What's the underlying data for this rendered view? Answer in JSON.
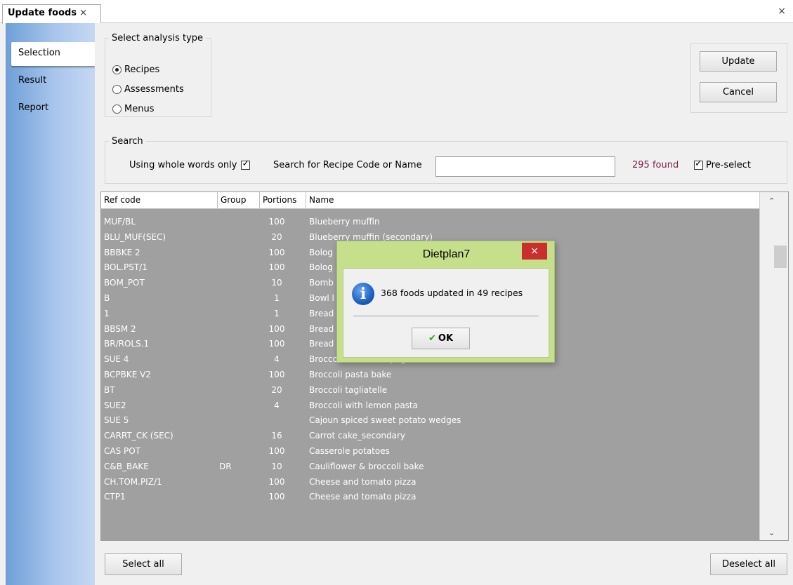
{
  "tab": {
    "title": "Update foods",
    "close": "×"
  },
  "window_close": "×",
  "sidebar": {
    "items": [
      {
        "label": "Selection"
      },
      {
        "label": "Result"
      },
      {
        "label": "Report"
      }
    ]
  },
  "analysis": {
    "legend": "Select analysis type",
    "options": [
      {
        "label": "Recipes",
        "checked": true
      },
      {
        "label": "Assessments",
        "checked": false
      },
      {
        "label": "Menus",
        "checked": false
      }
    ]
  },
  "actions": {
    "update_label": "Update",
    "cancel_label": "Cancel"
  },
  "search": {
    "legend": "Search",
    "whole_words_label": "Using whole words only",
    "whole_words_checked": true,
    "search_label": "Search for Recipe Code or Name",
    "search_value": "",
    "found_text": "295 found",
    "preselect_label": "Pre-select",
    "preselect_checked": true
  },
  "grid": {
    "headers": {
      "ref": "Ref code",
      "group": "Group",
      "portions": "Portions",
      "name": "Name"
    },
    "rows": [
      {
        "ref": "MUF/BL",
        "group": "",
        "portions": "100",
        "name": "Blueberry muffin"
      },
      {
        "ref": "BLU_MUF(SEC)",
        "group": "",
        "portions": "20",
        "name": "Blueberry muffin (secondary)"
      },
      {
        "ref": "BBBKE 2",
        "group": "",
        "portions": "100",
        "name": "Bolog"
      },
      {
        "ref": "BOL.PST/1",
        "group": "",
        "portions": "100",
        "name": "Bolog"
      },
      {
        "ref": "BOM_POT",
        "group": "",
        "portions": "10",
        "name": "Bomb"
      },
      {
        "ref": "B",
        "group": "",
        "portions": "1",
        "name": "Bowl l"
      },
      {
        "ref": "1",
        "group": "",
        "portions": "1",
        "name": "Bread"
      },
      {
        "ref": "BBSM 2",
        "group": "",
        "portions": "100",
        "name": "Bread"
      },
      {
        "ref": "BR/ROLS.1",
        "group": "",
        "portions": "100",
        "name": "Bread"
      },
      {
        "ref": "SUE 4",
        "group": "",
        "portions": "4",
        "name": "Broccoli and chilli spaghetti"
      },
      {
        "ref": "BCPBKE V2",
        "group": "",
        "portions": "100",
        "name": "Broccoli pasta bake"
      },
      {
        "ref": "BT",
        "group": "",
        "portions": "20",
        "name": "Broccoli tagliatelle"
      },
      {
        "ref": "SUE2",
        "group": "",
        "portions": "4",
        "name": "Broccoli with lemon pasta"
      },
      {
        "ref": "SUE 5",
        "group": "",
        "portions": "",
        "name": "Cajoun spiced sweet potato wedges"
      },
      {
        "ref": "CARRT_CK (SEC)",
        "group": "",
        "portions": "16",
        "name": "Carrot cake_secondary"
      },
      {
        "ref": "CAS POT",
        "group": "",
        "portions": "100",
        "name": "Casserole potatoes"
      },
      {
        "ref": "C&B_BAKE",
        "group": "DR",
        "portions": "10",
        "name": "Cauliflower & broccoli bake"
      },
      {
        "ref": "CH.TOM.PIZ/1",
        "group": "",
        "portions": "100",
        "name": "Cheese and tomato pizza"
      },
      {
        "ref": "CTP1",
        "group": "",
        "portions": "100",
        "name": "Cheese and tomato pizza"
      }
    ]
  },
  "footer": {
    "select_all": "Select all",
    "deselect_all": "Deselect all"
  },
  "dialog": {
    "title": "Dietplan7",
    "close": "×",
    "message": "368 foods updated in 49 recipes",
    "ok_label": "OK"
  },
  "colors": {
    "sidebar_gradient_start": "#6f9fd8",
    "grid_bg": "#a0a0a0",
    "found_text": "#7a1f4a",
    "dialog_frame": "#c6df8b",
    "close_red": "#c9302c"
  }
}
